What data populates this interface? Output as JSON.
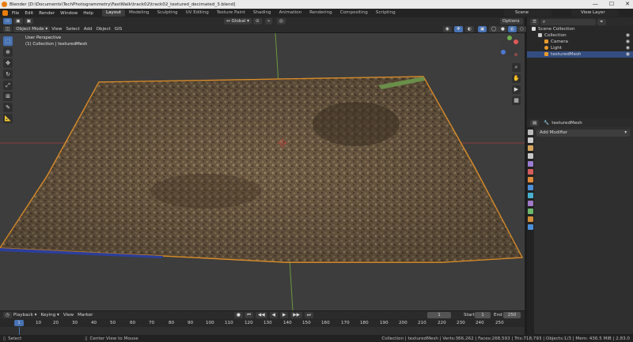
{
  "title_bar": {
    "text": "Blender [D:\\Documents\\TechPhotogrammetry\\FastWalk\\track02\\track02_textured_decimated_3.blend]",
    "min": "—",
    "max": "☐",
    "close": "✕"
  },
  "menu": [
    "File",
    "Edit",
    "Render",
    "Window",
    "Help"
  ],
  "workspaces": [
    "Layout",
    "Modeling",
    "Sculpting",
    "UV Editing",
    "Texture Paint",
    "Shading",
    "Animation",
    "Rendering",
    "Compositing",
    "Scripting"
  ],
  "scene_label": "Scene",
  "view_layer_label": "View Layer",
  "viewport_header": {
    "mode": "Object Mode",
    "menus": [
      "View",
      "Select",
      "Add",
      "Object",
      "GIS"
    ],
    "transform_orientation": "Global",
    "options": "Options"
  },
  "viewport": {
    "perspective_label": "User Perspective",
    "collection_label": "(1) Collection | texturedMesh"
  },
  "outliner": {
    "rows": [
      {
        "label": "Scene Collection",
        "indent": 0,
        "color": "#ffffff"
      },
      {
        "label": "Collection",
        "indent": 1,
        "color": "#cfcfcf"
      },
      {
        "label": "Camera",
        "indent": 2,
        "color": "#e89a2c"
      },
      {
        "label": "Light",
        "indent": 2,
        "color": "#e89a2c"
      },
      {
        "label": "texturedMesh",
        "indent": 2,
        "color": "#e89a2c",
        "selected": true
      }
    ]
  },
  "properties": {
    "object_name": "texturedMesh",
    "add_modifier": "Add Modifier",
    "tab_colors": [
      "#bbbbbb",
      "#cccccc",
      "#d6a55b",
      "#c8c8c8",
      "#9b7ed3",
      "#d45d5d",
      "#e08a3a",
      "#4d8fd6",
      "#4ab0d0",
      "#a17ac8",
      "#6db96d",
      "#d48e3a",
      "#4d8fd6"
    ]
  },
  "timeline": {
    "menus": [
      "Playback",
      "Keying",
      "View",
      "Marker"
    ],
    "current_frame": "1",
    "start_label": "Start",
    "start": "1",
    "end_label": "End",
    "end": "250",
    "ruler": [
      "1",
      "10",
      "20",
      "30",
      "40",
      "50",
      "60",
      "70",
      "80",
      "90",
      "100",
      "110",
      "120",
      "130",
      "140",
      "150",
      "160",
      "170",
      "180",
      "190",
      "200",
      "210",
      "220",
      "230",
      "240",
      "250"
    ]
  },
  "status_bar": {
    "left": "Select",
    "middle1": "Center View to Mouse",
    "right": "Collection | texturedMesh | Verts:366,262 | Faces:268,593 | Tris:718,793 | Objects:1/3 | Mem: 436.5 MiB | 2.83.0"
  }
}
